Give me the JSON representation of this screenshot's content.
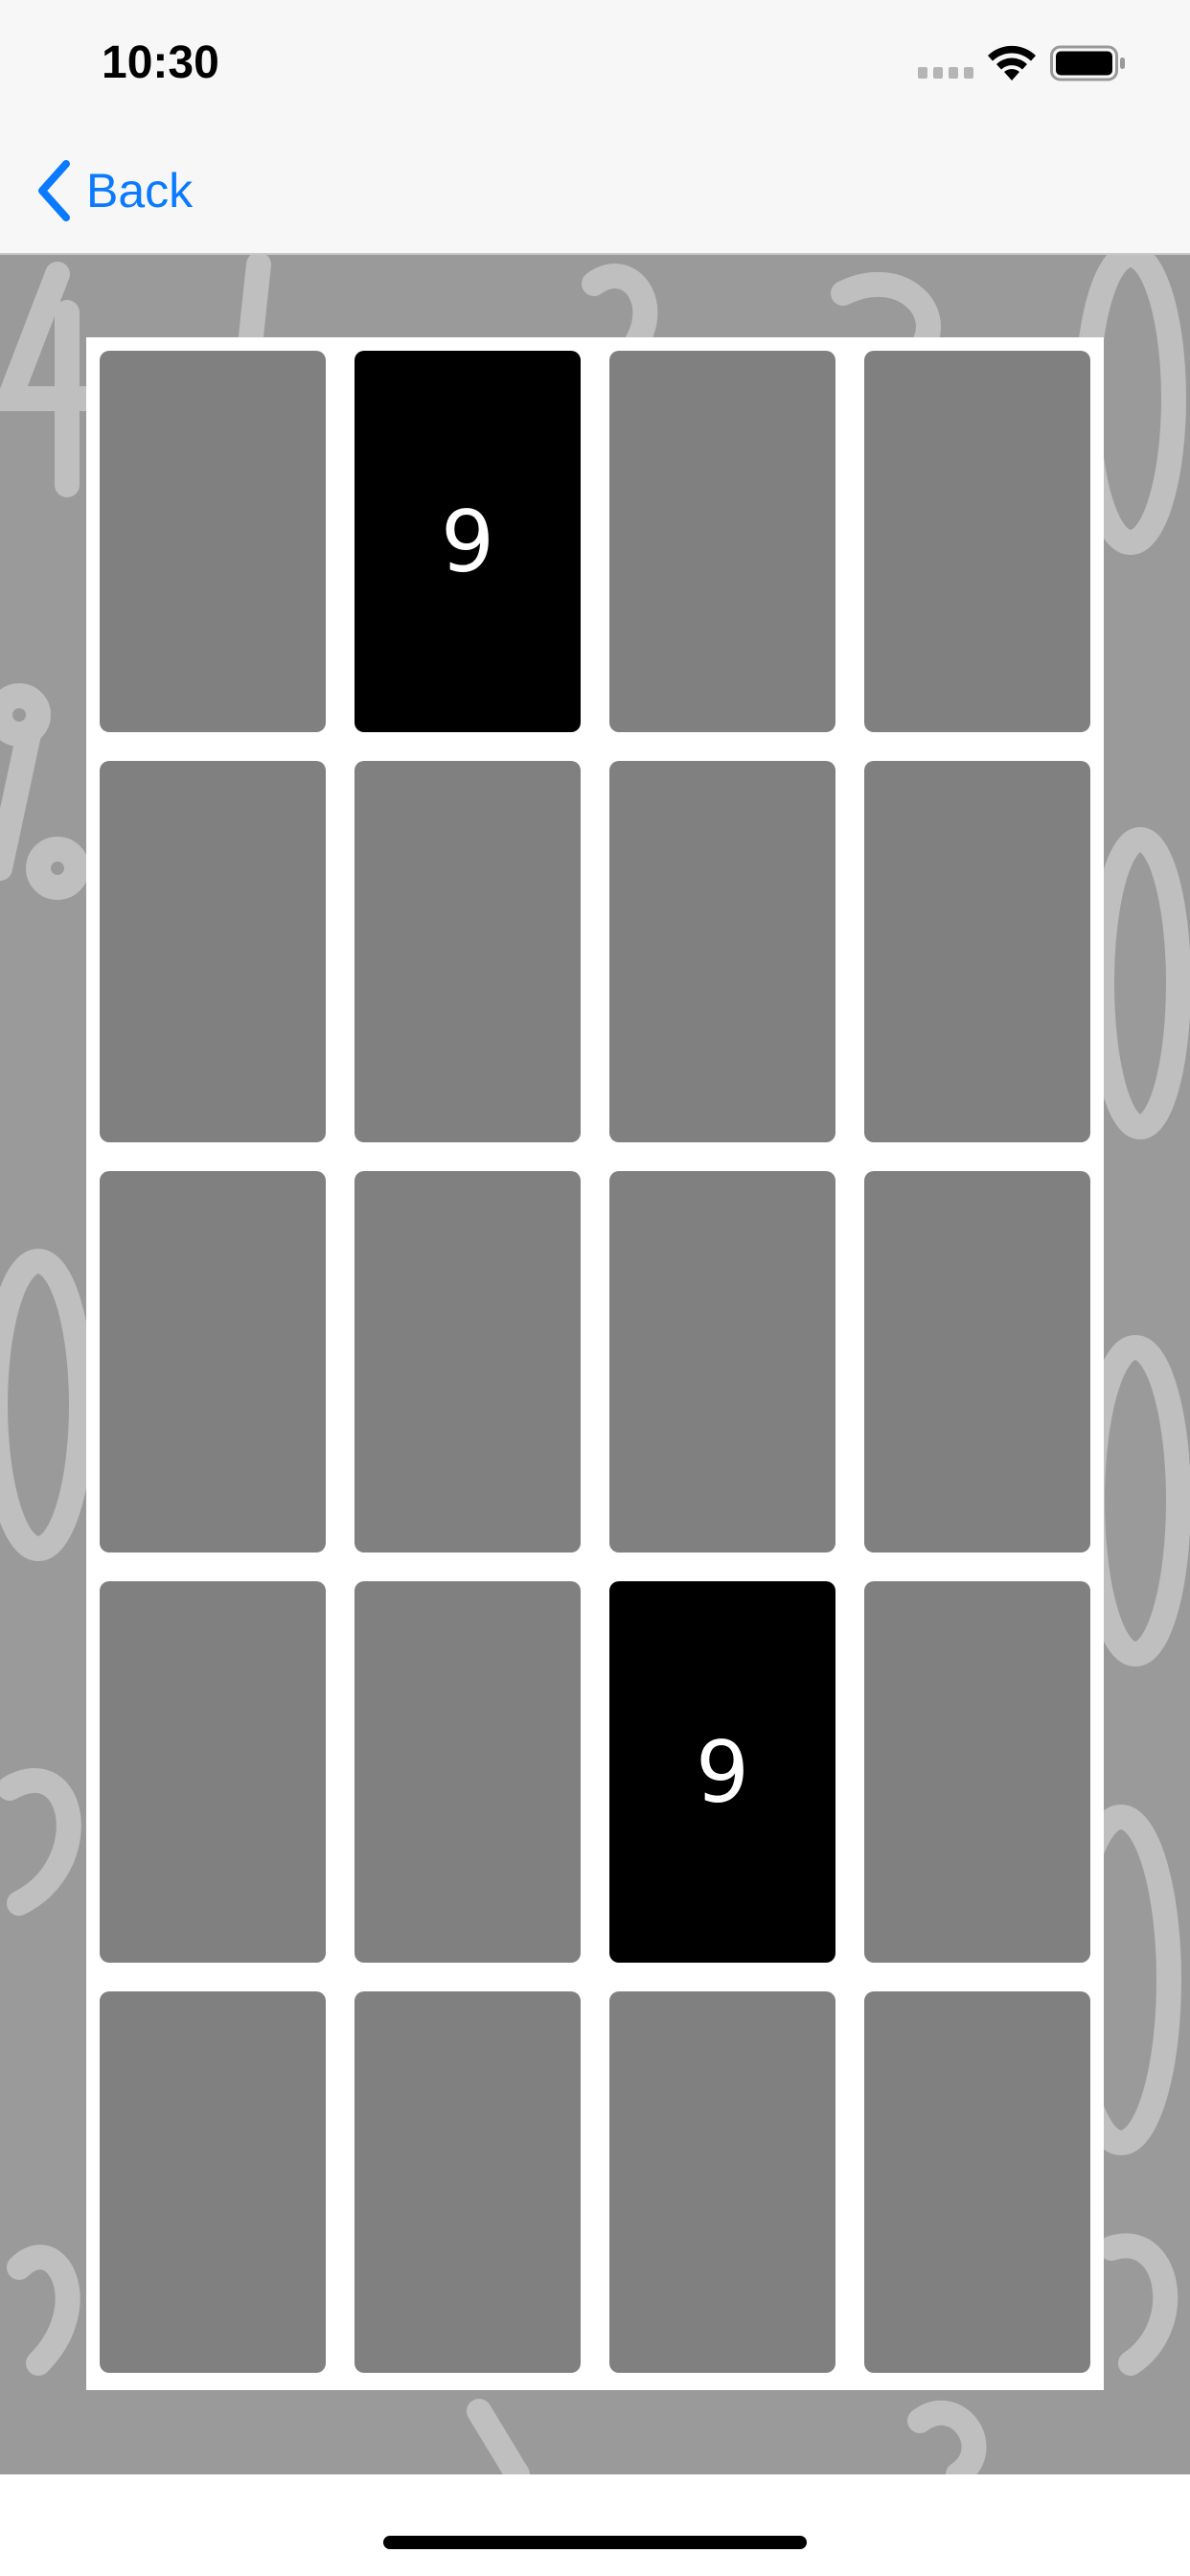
{
  "status": {
    "time": "10:30"
  },
  "nav": {
    "back_label": "Back"
  },
  "colors": {
    "accent": "#0a7aff",
    "tile_hidden": "#808080",
    "tile_revealed": "#000000",
    "board": "#ffffff",
    "background": "#9a9a9a"
  },
  "board": {
    "rows": 5,
    "columns": 4,
    "tiles": [
      [
        {
          "revealed": false,
          "value": ""
        },
        {
          "revealed": true,
          "value": "9"
        },
        {
          "revealed": false,
          "value": ""
        },
        {
          "revealed": false,
          "value": ""
        }
      ],
      [
        {
          "revealed": false,
          "value": ""
        },
        {
          "revealed": false,
          "value": ""
        },
        {
          "revealed": false,
          "value": ""
        },
        {
          "revealed": false,
          "value": ""
        }
      ],
      [
        {
          "revealed": false,
          "value": ""
        },
        {
          "revealed": false,
          "value": ""
        },
        {
          "revealed": false,
          "value": ""
        },
        {
          "revealed": false,
          "value": ""
        }
      ],
      [
        {
          "revealed": false,
          "value": ""
        },
        {
          "revealed": false,
          "value": ""
        },
        {
          "revealed": true,
          "value": "9"
        },
        {
          "revealed": false,
          "value": ""
        }
      ],
      [
        {
          "revealed": false,
          "value": ""
        },
        {
          "revealed": false,
          "value": ""
        },
        {
          "revealed": false,
          "value": ""
        },
        {
          "revealed": false,
          "value": ""
        }
      ]
    ]
  }
}
